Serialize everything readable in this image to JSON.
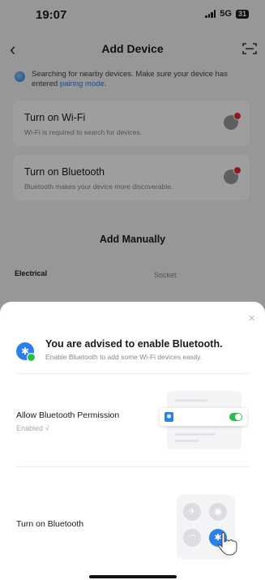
{
  "status": {
    "time": "19:07",
    "network": "5G",
    "battery": "31"
  },
  "nav": {
    "title": "Add Device",
    "back_icon": "chevron-left-icon",
    "scan_icon": "scan-icon"
  },
  "notice": {
    "text": "Searching for nearby devices. Make sure your device has entered ",
    "link": "pairing mode",
    "suffix": "."
  },
  "cards": [
    {
      "title": "Turn on Wi-Fi",
      "subtitle": "Wi-Fi is required to search for devices."
    },
    {
      "title": "Turn on Bluetooth",
      "subtitle": "Bluetooth makes your device more discoverable."
    }
  ],
  "add_manually": {
    "title": "Add Manually",
    "category_selected": "Electrical",
    "category_item": "Socket"
  },
  "sheet": {
    "close_label": "×",
    "advice_title": "You are advised to enable Bluetooth.",
    "advice_subtitle": "Enable Bluetooth to add some Wi-Fi devices easily.",
    "permission_title": "Allow Bluetooth Permission",
    "permission_status": "Enabled √",
    "turn_on_title": "Turn on Bluetooth"
  },
  "colors": {
    "accent": "#2a7fe8",
    "success": "#2dbb4e",
    "alert": "#e82a2a"
  }
}
